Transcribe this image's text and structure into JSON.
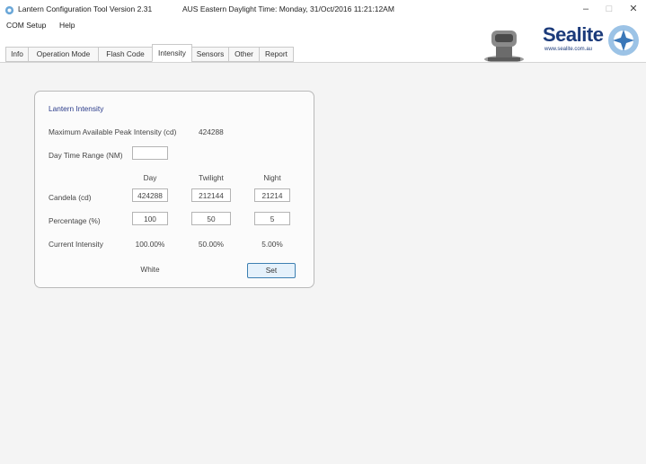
{
  "window": {
    "title": "Lantern Configuration Tool Version 2.31",
    "time_text": "AUS Eastern Daylight Time: Monday, 31/Oct/2016 11:21:12AM",
    "minimize": "–",
    "maximize": "□",
    "close": "✕"
  },
  "menu": {
    "items": [
      "COM Setup",
      "Help"
    ]
  },
  "tabs": [
    {
      "label": "Info"
    },
    {
      "label": "Operation Mode"
    },
    {
      "label": "Flash Code"
    },
    {
      "label": "Intensity",
      "active": true
    },
    {
      "label": "Sensors"
    },
    {
      "label": "Other"
    },
    {
      "label": "Report"
    }
  ],
  "logo": {
    "text": "Sealite",
    "sub": "www.sealite.com.au",
    "brand_color": "#1b3a7a"
  },
  "panel": {
    "heading": "Lantern Intensity",
    "max_peak_label": "Maximum Available Peak Intensity (cd)",
    "max_peak_value": "424288",
    "day_range_label": "Day Time Range (NM)",
    "day_range_value": "",
    "columns": [
      "Day",
      "Twilight",
      "Night"
    ],
    "candela_label": "Candela (cd)",
    "candela": [
      "424288",
      "212144",
      "21214"
    ],
    "percentage_label": "Percentage (%)",
    "percentage": [
      "100",
      "50",
      "5"
    ],
    "current_label": "Current Intensity",
    "current": [
      "100.00%",
      "50.00%",
      "5.00%"
    ],
    "color_text": "White",
    "set_button": "Set",
    "heading_color": "#2a3b8a",
    "set_border_color": "#3c7fb1"
  }
}
